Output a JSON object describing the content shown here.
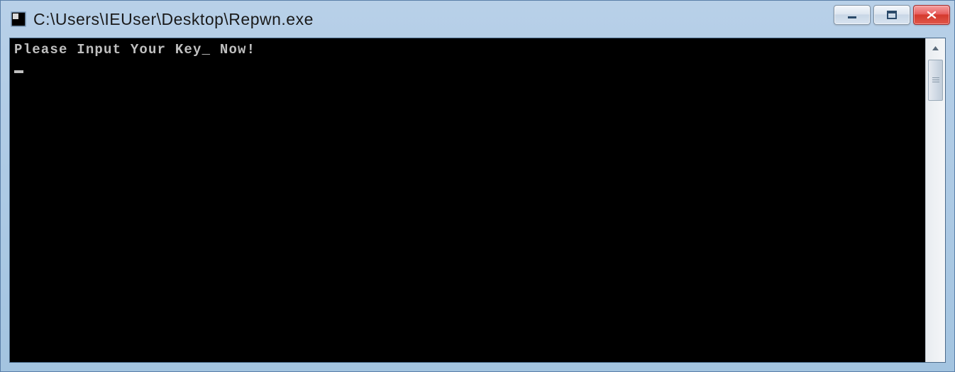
{
  "window": {
    "title": "C:\\Users\\IEUser\\Desktop\\Repwn.exe"
  },
  "console": {
    "prompt_line": "Please Input Your Key_ Now!",
    "input_value": ""
  }
}
